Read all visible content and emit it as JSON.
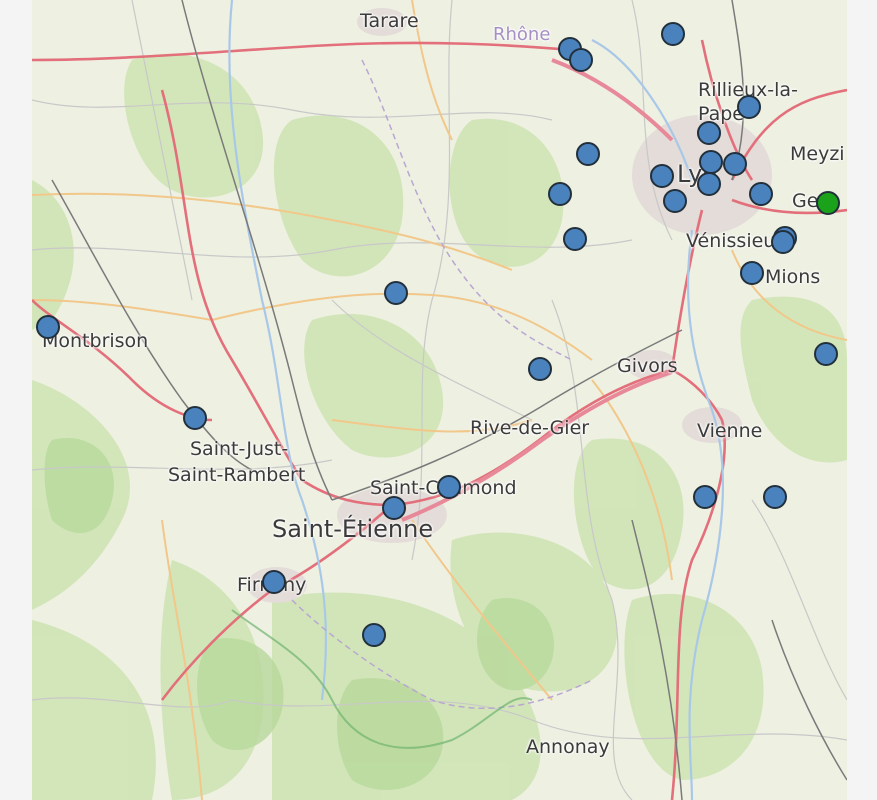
{
  "map": {
    "labels": {
      "tarare": "Tarare",
      "rhone": "Rhône",
      "rillieux": "Rillieux-la-Pape",
      "meyzieu": "Meyzi",
      "lyon": "Lyo",
      "genas": "Ge",
      "venissieux": "Vénissieux",
      "mions": "Mions",
      "montbrison": "Montbrison",
      "givors": "Givors",
      "rive_de_gier": "Rive-de-Gier",
      "vienne": "Vienne",
      "saint_just_1": "Saint-Just-",
      "saint_just_2": "Saint-Rambert",
      "saint_chamond": "Saint-Chamond",
      "saint_etienne": "Saint-Étienne",
      "firminy": "Firminy",
      "annonay": "Annonay"
    },
    "marker_colors": {
      "default": "#4a82bd",
      "highlight": "#1aa31a"
    }
  }
}
